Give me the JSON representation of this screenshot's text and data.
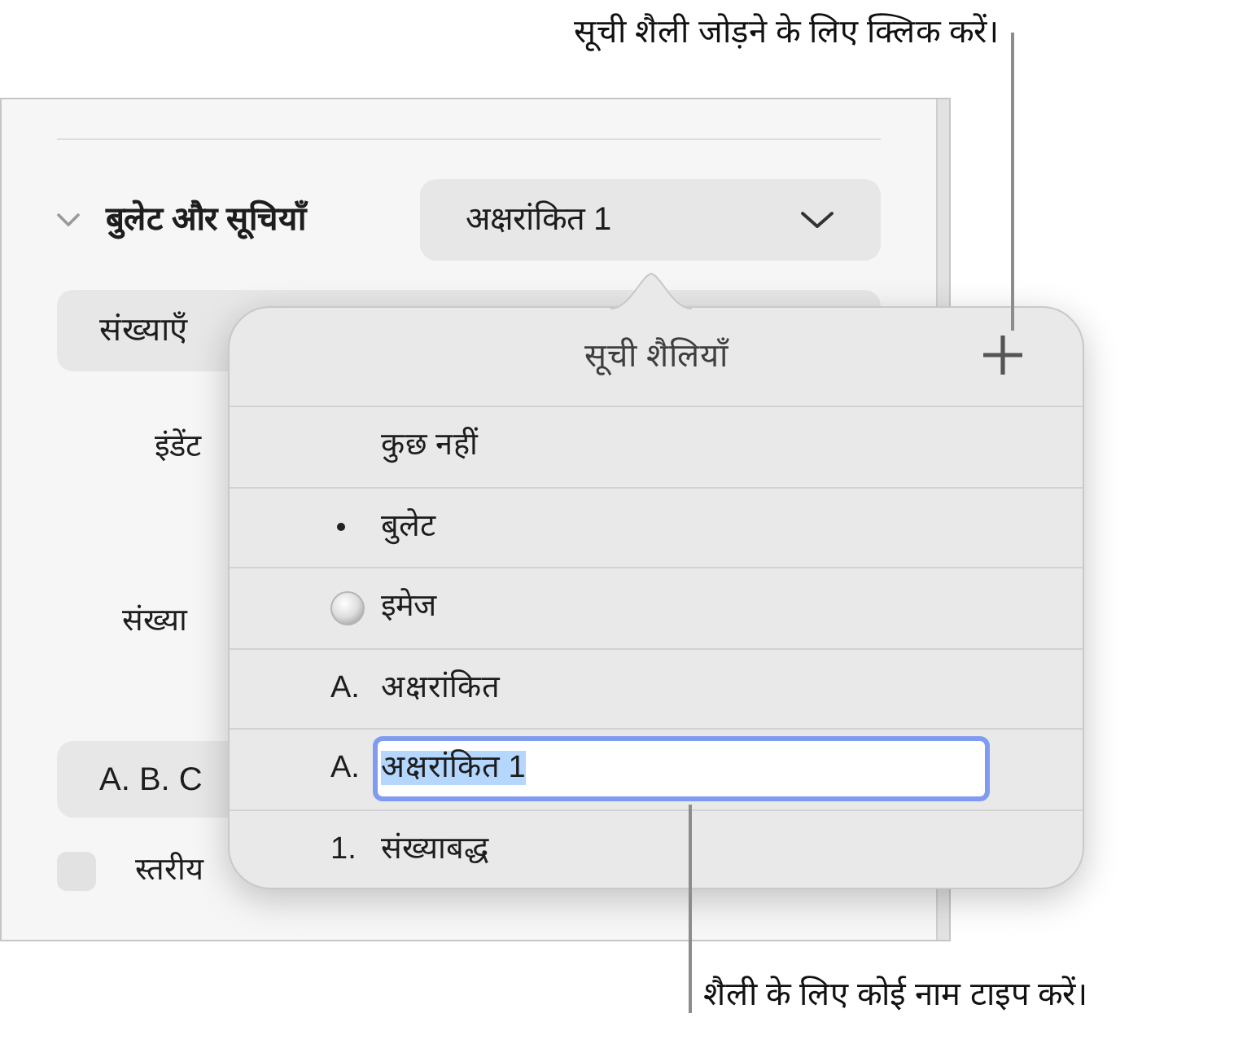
{
  "callouts": [
    {
      "text": "सूची शैली जोड़ने के लिए क्लिक करें।"
    },
    {
      "text": "शैली के लिए कोई नाम टाइप करें।"
    }
  ],
  "sidebar": {
    "section": {
      "title": "बुलेट और सूचियाँ",
      "expanded": true
    },
    "style_popup": "अक्षरांकित 1",
    "type_popup": "संख्याएँ",
    "indent_label": "इंडेंट",
    "number_label": "संख्या",
    "format_popup": "A. B. C",
    "tiered_checkbox": {
      "label": "स्तरीय",
      "checked": false
    }
  },
  "popover": {
    "title": "सूची शैलियाँ",
    "styles": [
      {
        "kind": "none",
        "label": "कुछ नहीं",
        "editing": false
      },
      {
        "kind": "bullet",
        "label": "बुलेट",
        "editing": false
      },
      {
        "kind": "image",
        "label": "इमेज",
        "editing": false
      },
      {
        "kind": "text",
        "marker": "A.",
        "label": "अक्षरांकित",
        "editing": false
      },
      {
        "kind": "text",
        "marker": "A.",
        "label": "अक्षरांकित 1",
        "editing": true,
        "text_selected": true
      },
      {
        "kind": "text",
        "marker": "1.",
        "label": "संख्याबद्ध",
        "editing": false
      }
    ]
  }
}
